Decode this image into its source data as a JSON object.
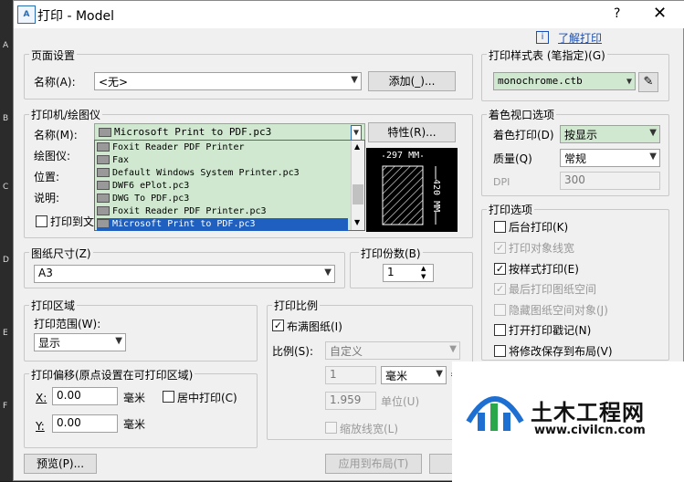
{
  "window": {
    "title": "打印 - Model",
    "help_symbol": "?",
    "close_symbol": "✕",
    "app_icon": "autocad-icon",
    "app_icon_text": "A"
  },
  "help_link": {
    "icon": "info-icon",
    "icon_text": "i",
    "label": "了解打印"
  },
  "page_setup": {
    "group_title": "页面设置",
    "name_label": "名称(A):",
    "name_value": "<无>",
    "add_button": "添加(_)..."
  },
  "printer": {
    "group_title": "打印机/绘图仪",
    "name_label": "名称(M):",
    "name_value": "Microsoft Print to PDF.pc3",
    "properties_button": "特性(R)...",
    "plotter_label": "绘图仪:",
    "location_label": "位置:",
    "description_label": "说明:",
    "print_to_file_label": "打印到文",
    "dropdown_items": [
      "Foxit Reader PDF Printer",
      "Fax",
      "Default Windows System Printer.pc3",
      "DWF6 ePlot.pc3",
      "DWG To PDF.pc3",
      "Foxit Reader PDF Printer.pc3",
      "Microsoft Print to PDF.pc3"
    ],
    "preview": {
      "width_label": "297 MM",
      "height_label": "420 MM"
    }
  },
  "paper_size": {
    "group_title": "图纸尺寸(Z)",
    "value": "A3"
  },
  "copies": {
    "group_title": "打印份数(B)",
    "value": "1"
  },
  "plot_area": {
    "group_title": "打印区域",
    "range_label": "打印范围(W):",
    "range_value": "显示"
  },
  "plot_offset": {
    "group_title": "打印偏移(原点设置在可打印区域)",
    "x_label": "X:",
    "x_value": "0.00",
    "x_unit": "毫米",
    "y_label": "Y:",
    "y_value": "0.00",
    "y_unit": "毫米",
    "center_label": "居中打印(C)"
  },
  "plot_scale": {
    "group_title": "打印比例",
    "fit_label": "布满图纸(I)",
    "scale_label": "比例(S):",
    "scale_value": "自定义",
    "value1": "1",
    "unit_value": "毫米",
    "equals": "=",
    "value2": "1.959",
    "unit_label": "单位(U)",
    "lineweight_label": "缩放线宽(L)"
  },
  "plot_style": {
    "group_title": "打印样式表 (笔指定)(G)",
    "value": "monochrome.ctb",
    "edit_icon": "pen-edit-icon"
  },
  "shaded_viewport": {
    "group_title": "着色视口选项",
    "shade_label": "着色打印(D)",
    "shade_value": "按显示",
    "quality_label": "质量(Q)",
    "quality_value": "常规",
    "dpi_label": "DPI",
    "dpi_value": "300"
  },
  "plot_options": {
    "group_title": "打印选项",
    "items": [
      {
        "label": "后台打印(K)",
        "checked": false,
        "enabled": true
      },
      {
        "label": "打印对象线宽",
        "checked": true,
        "enabled": false
      },
      {
        "label": "按样式打印(E)",
        "checked": true,
        "enabled": true
      },
      {
        "label": "最后打印图纸空间",
        "checked": true,
        "enabled": false
      },
      {
        "label": "隐藏图纸空间对象(J)",
        "checked": false,
        "enabled": false
      },
      {
        "label": "打开打印戳记(N)",
        "checked": false,
        "enabled": true
      },
      {
        "label": "将修改保存到布局(V)",
        "checked": false,
        "enabled": true
      }
    ]
  },
  "footer": {
    "preview_button": "预览(P)...",
    "apply_button": "应用到布局(T)"
  },
  "watermark": {
    "brand": "土木工程网",
    "url": "www.civilcn.com"
  },
  "colors": {
    "selection": "#1f5fbf",
    "green_field": "#cfe8cf",
    "link": "#1a4fb5"
  }
}
